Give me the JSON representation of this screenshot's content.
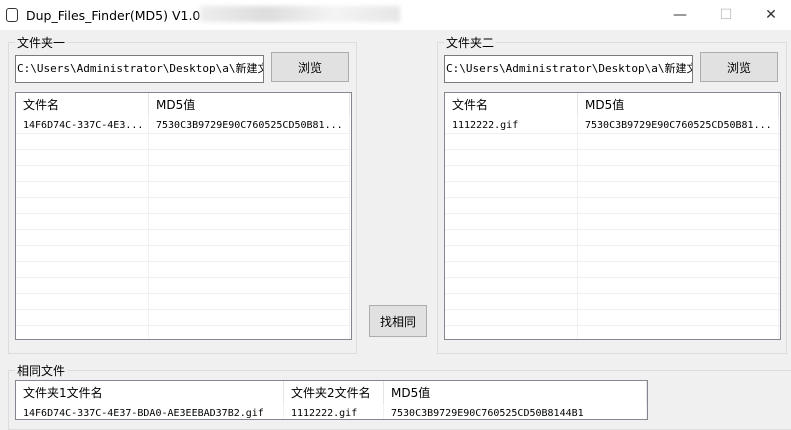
{
  "window": {
    "title": "Dup_Files_Finder(MD5) V1.0",
    "min": "—",
    "max": "☐",
    "close": "✕"
  },
  "folder1": {
    "label": "文件夹一",
    "path": "C:\\Users\\Administrator\\Desktop\\a\\新建文件",
    "browse": "浏览",
    "columns": [
      "文件名",
      "MD5值"
    ],
    "rows": [
      [
        "14F6D74C-337C-4E3...",
        "7530C3B9729E90C760525CD50B81..."
      ]
    ]
  },
  "folder2": {
    "label": "文件夹二",
    "path": "C:\\Users\\Administrator\\Desktop\\a\\新建文件",
    "browse": "浏览",
    "columns": [
      "文件名",
      "MD5值"
    ],
    "rows": [
      [
        "1112222.gif",
        "7530C3B9729E90C760525CD50B81..."
      ]
    ]
  },
  "find_button": "找相同",
  "same": {
    "label": "相同文件",
    "columns": [
      "文件夹1文件名",
      "文件夹2文件名",
      "MD5值"
    ],
    "rows": [
      [
        "14F6D74C-337C-4E37-BDA0-AE3EEBAD37B2.gif",
        "1112222.gif",
        "7530C3B9729E90C760525CD50B8144B1"
      ]
    ]
  }
}
